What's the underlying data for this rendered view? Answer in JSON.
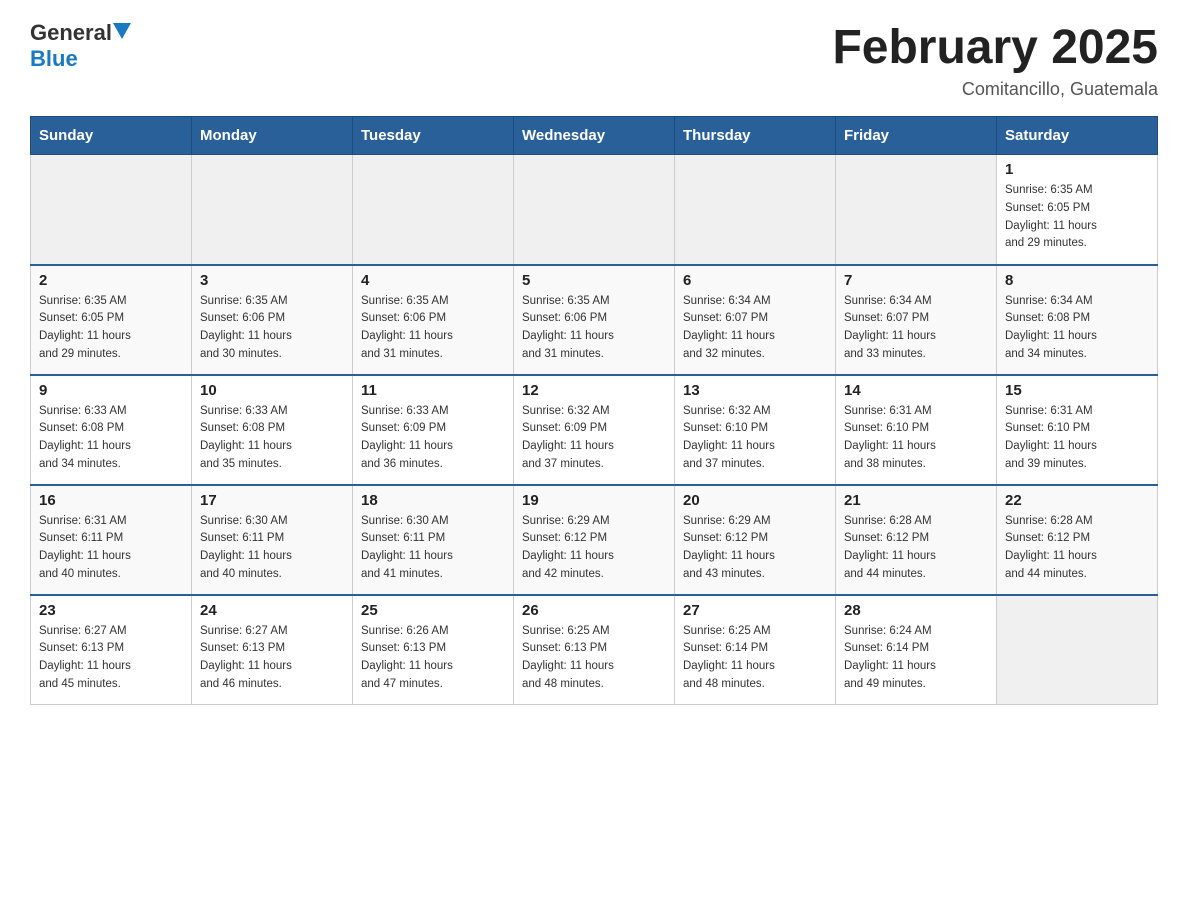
{
  "header": {
    "logo_text_general": "General",
    "logo_text_blue": "Blue",
    "title": "February 2025",
    "subtitle": "Comitancillo, Guatemala"
  },
  "days_of_week": [
    "Sunday",
    "Monday",
    "Tuesday",
    "Wednesday",
    "Thursday",
    "Friday",
    "Saturday"
  ],
  "weeks": [
    {
      "days": [
        {
          "number": "",
          "info": ""
        },
        {
          "number": "",
          "info": ""
        },
        {
          "number": "",
          "info": ""
        },
        {
          "number": "",
          "info": ""
        },
        {
          "number": "",
          "info": ""
        },
        {
          "number": "",
          "info": ""
        },
        {
          "number": "1",
          "info": "Sunrise: 6:35 AM\nSunset: 6:05 PM\nDaylight: 11 hours\nand 29 minutes."
        }
      ]
    },
    {
      "days": [
        {
          "number": "2",
          "info": "Sunrise: 6:35 AM\nSunset: 6:05 PM\nDaylight: 11 hours\nand 29 minutes."
        },
        {
          "number": "3",
          "info": "Sunrise: 6:35 AM\nSunset: 6:06 PM\nDaylight: 11 hours\nand 30 minutes."
        },
        {
          "number": "4",
          "info": "Sunrise: 6:35 AM\nSunset: 6:06 PM\nDaylight: 11 hours\nand 31 minutes."
        },
        {
          "number": "5",
          "info": "Sunrise: 6:35 AM\nSunset: 6:06 PM\nDaylight: 11 hours\nand 31 minutes."
        },
        {
          "number": "6",
          "info": "Sunrise: 6:34 AM\nSunset: 6:07 PM\nDaylight: 11 hours\nand 32 minutes."
        },
        {
          "number": "7",
          "info": "Sunrise: 6:34 AM\nSunset: 6:07 PM\nDaylight: 11 hours\nand 33 minutes."
        },
        {
          "number": "8",
          "info": "Sunrise: 6:34 AM\nSunset: 6:08 PM\nDaylight: 11 hours\nand 34 minutes."
        }
      ]
    },
    {
      "days": [
        {
          "number": "9",
          "info": "Sunrise: 6:33 AM\nSunset: 6:08 PM\nDaylight: 11 hours\nand 34 minutes."
        },
        {
          "number": "10",
          "info": "Sunrise: 6:33 AM\nSunset: 6:08 PM\nDaylight: 11 hours\nand 35 minutes."
        },
        {
          "number": "11",
          "info": "Sunrise: 6:33 AM\nSunset: 6:09 PM\nDaylight: 11 hours\nand 36 minutes."
        },
        {
          "number": "12",
          "info": "Sunrise: 6:32 AM\nSunset: 6:09 PM\nDaylight: 11 hours\nand 37 minutes."
        },
        {
          "number": "13",
          "info": "Sunrise: 6:32 AM\nSunset: 6:10 PM\nDaylight: 11 hours\nand 37 minutes."
        },
        {
          "number": "14",
          "info": "Sunrise: 6:31 AM\nSunset: 6:10 PM\nDaylight: 11 hours\nand 38 minutes."
        },
        {
          "number": "15",
          "info": "Sunrise: 6:31 AM\nSunset: 6:10 PM\nDaylight: 11 hours\nand 39 minutes."
        }
      ]
    },
    {
      "days": [
        {
          "number": "16",
          "info": "Sunrise: 6:31 AM\nSunset: 6:11 PM\nDaylight: 11 hours\nand 40 minutes."
        },
        {
          "number": "17",
          "info": "Sunrise: 6:30 AM\nSunset: 6:11 PM\nDaylight: 11 hours\nand 40 minutes."
        },
        {
          "number": "18",
          "info": "Sunrise: 6:30 AM\nSunset: 6:11 PM\nDaylight: 11 hours\nand 41 minutes."
        },
        {
          "number": "19",
          "info": "Sunrise: 6:29 AM\nSunset: 6:12 PM\nDaylight: 11 hours\nand 42 minutes."
        },
        {
          "number": "20",
          "info": "Sunrise: 6:29 AM\nSunset: 6:12 PM\nDaylight: 11 hours\nand 43 minutes."
        },
        {
          "number": "21",
          "info": "Sunrise: 6:28 AM\nSunset: 6:12 PM\nDaylight: 11 hours\nand 44 minutes."
        },
        {
          "number": "22",
          "info": "Sunrise: 6:28 AM\nSunset: 6:12 PM\nDaylight: 11 hours\nand 44 minutes."
        }
      ]
    },
    {
      "days": [
        {
          "number": "23",
          "info": "Sunrise: 6:27 AM\nSunset: 6:13 PM\nDaylight: 11 hours\nand 45 minutes."
        },
        {
          "number": "24",
          "info": "Sunrise: 6:27 AM\nSunset: 6:13 PM\nDaylight: 11 hours\nand 46 minutes."
        },
        {
          "number": "25",
          "info": "Sunrise: 6:26 AM\nSunset: 6:13 PM\nDaylight: 11 hours\nand 47 minutes."
        },
        {
          "number": "26",
          "info": "Sunrise: 6:25 AM\nSunset: 6:13 PM\nDaylight: 11 hours\nand 48 minutes."
        },
        {
          "number": "27",
          "info": "Sunrise: 6:25 AM\nSunset: 6:14 PM\nDaylight: 11 hours\nand 48 minutes."
        },
        {
          "number": "28",
          "info": "Sunrise: 6:24 AM\nSunset: 6:14 PM\nDaylight: 11 hours\nand 49 minutes."
        },
        {
          "number": "",
          "info": ""
        }
      ]
    }
  ]
}
